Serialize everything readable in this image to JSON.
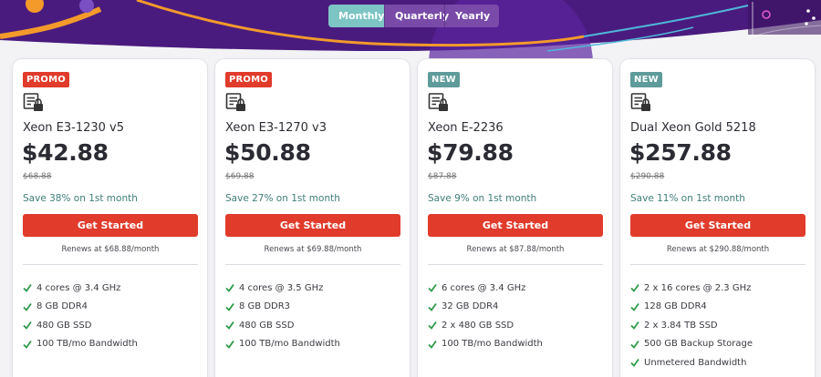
{
  "billing_toggle": {
    "options": [
      "Monthly",
      "Quarterly",
      "Yearly"
    ],
    "active": "Monthly"
  },
  "colors": {
    "accent_red": "#e03b2b",
    "accent_teal": "#5e9b9a",
    "toggle_active": "#7dc4c4",
    "hero_purple": "#4a1b7e",
    "save_text": "#3f7e79",
    "check_green": "#2e9a4a"
  },
  "icons": {
    "server": "server-lock-icon",
    "feature": "check-icon"
  },
  "cards": [
    {
      "badge": "PROMO",
      "badge_type": "promo",
      "name": "Xeon E3-1230 v5",
      "price": "$42.88",
      "old_price": "$68.88",
      "save": "Save 38% on 1st month",
      "cta": "Get Started",
      "renews": "Renews at $68.88/month",
      "features": [
        "4 cores @ 3.4 GHz",
        "8 GB DDR4",
        "480 GB SSD",
        "100 TB/mo Bandwidth"
      ]
    },
    {
      "badge": "PROMO",
      "badge_type": "promo",
      "name": "Xeon E3-1270 v3",
      "price": "$50.88",
      "old_price": "$69.88",
      "save": "Save 27% on 1st month",
      "cta": "Get Started",
      "renews": "Renews at $69.88/month",
      "features": [
        "4 cores @ 3.5 GHz",
        "8 GB DDR3",
        "480 GB SSD",
        "100 TB/mo Bandwidth"
      ]
    },
    {
      "badge": "NEW",
      "badge_type": "new",
      "name": "Xeon E-2236",
      "price": "$79.88",
      "old_price": "$87.88",
      "save": "Save 9% on 1st month",
      "cta": "Get Started",
      "renews": "Renews at $87.88/month",
      "features": [
        "6 cores @ 3.4 GHz",
        "32 GB DDR4",
        "2 x 480 GB SSD",
        "100 TB/mo Bandwidth"
      ]
    },
    {
      "badge": "NEW",
      "badge_type": "new",
      "name": "Dual Xeon Gold 5218",
      "price": "$257.88",
      "old_price": "$290.88",
      "save": "Save 11% on 1st month",
      "cta": "Get Started",
      "renews": "Renews at $290.88/month",
      "features": [
        "2 x 16 cores @ 2.3 GHz",
        "128 GB DDR4",
        "2 x 3.84 TB SSD",
        "500 GB Backup Storage",
        "Unmetered Bandwidth"
      ]
    }
  ]
}
